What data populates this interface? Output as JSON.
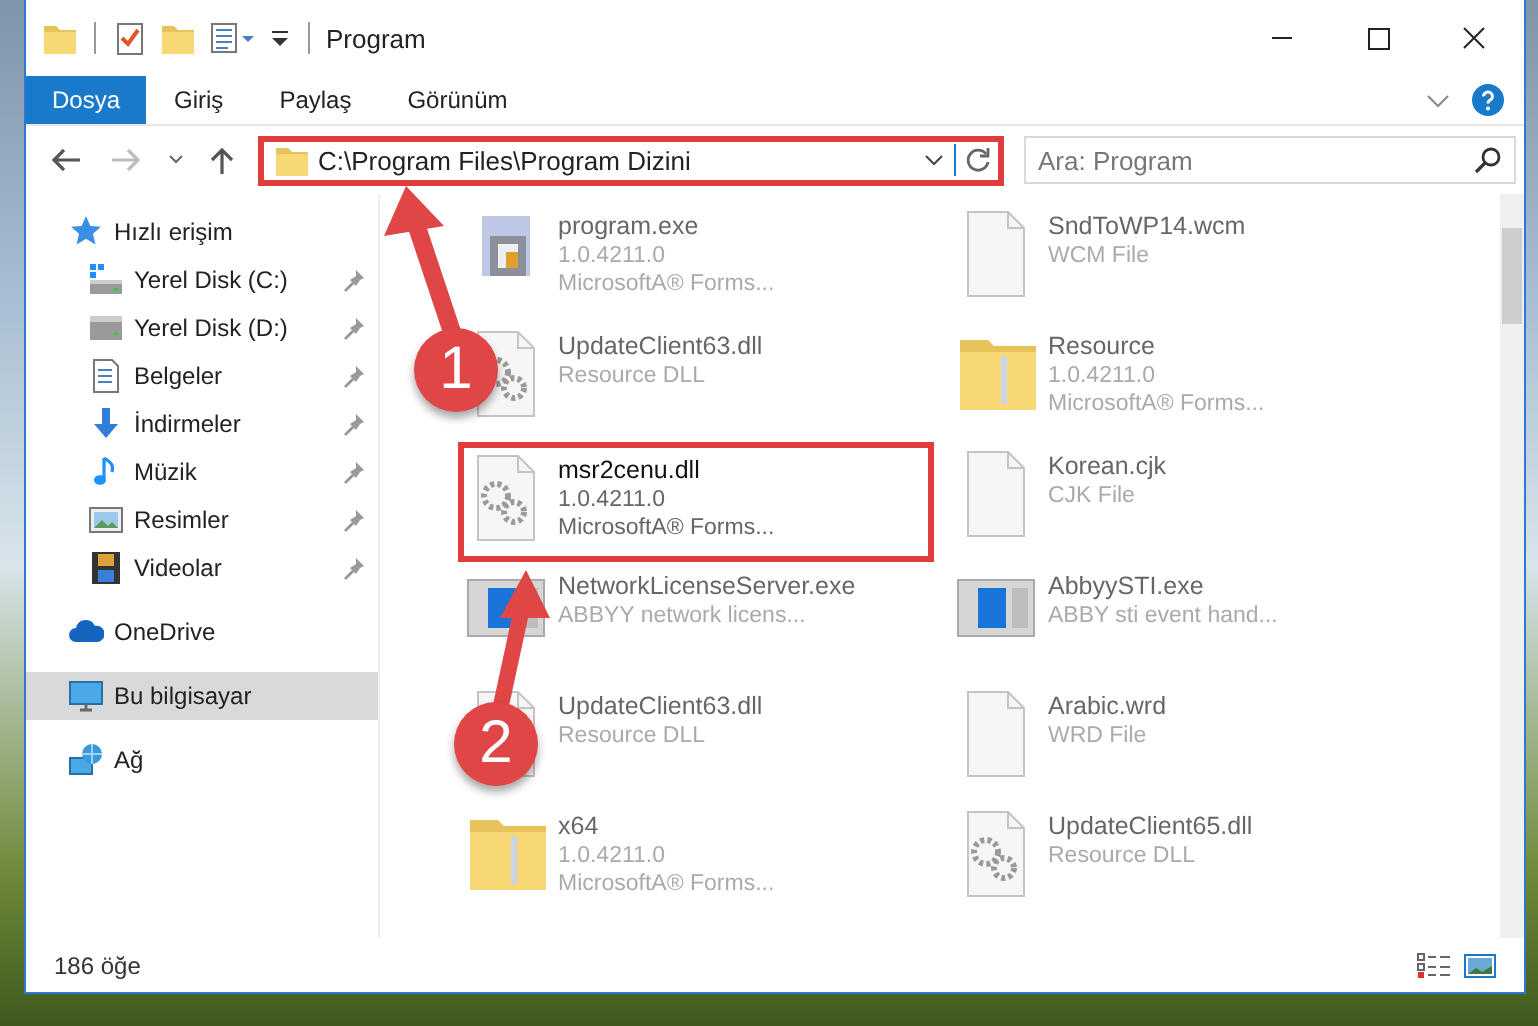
{
  "window": {
    "title": "Program"
  },
  "ribbon_tabs": [
    {
      "label": "Dosya",
      "kind": "menu",
      "selected": false
    },
    {
      "label": "Giriş",
      "kind": "tab",
      "selected": false
    },
    {
      "label": "Paylaş",
      "kind": "tab",
      "selected": false
    },
    {
      "label": "Görünüm",
      "kind": "tab",
      "selected": false
    }
  ],
  "address_bar": {
    "path": "C:\\Program Files\\Program Dizini",
    "highlighted": true
  },
  "search": {
    "placeholder": "Ara: Program"
  },
  "sidebar": {
    "items": [
      {
        "label": "Hızlı erişim",
        "kind": "star",
        "selected": false,
        "children": [
          {
            "label": "Yerel Disk (C:)",
            "kind": "system-drive",
            "selected": false,
            "pinned": true
          },
          {
            "label": "Yerel Disk (D:)",
            "kind": "drive",
            "selected": false,
            "pinned": true
          },
          {
            "label": "Belgeler",
            "kind": "documents",
            "selected": false,
            "pinned": true
          },
          {
            "label": "İndirmeler",
            "kind": "downloads",
            "selected": false,
            "pinned": true
          },
          {
            "label": "Müzik",
            "kind": "music",
            "selected": false,
            "pinned": true
          },
          {
            "label": "Resimler",
            "kind": "pictures",
            "selected": false,
            "pinned": true
          },
          {
            "label": "Videolar",
            "kind": "videos",
            "selected": false,
            "pinned": true
          }
        ]
      },
      {
        "label": "OneDrive",
        "kind": "cloud",
        "selected": false
      },
      {
        "label": "Bu bilgisayar",
        "kind": "computer",
        "selected": true
      },
      {
        "label": "Ağ",
        "kind": "network",
        "selected": false
      }
    ]
  },
  "files": [
    {
      "name": "program.exe",
      "kind": "program",
      "highlighted": false,
      "details": [
        "1.0.4211.0",
        "MicrosoftA® Forms..."
      ]
    },
    {
      "name": "SndToWP14.wcm",
      "kind": "document",
      "highlighted": false,
      "details": [
        "WCM File"
      ]
    },
    {
      "name": "UpdateClient63.dll",
      "kind": "dll",
      "highlighted": false,
      "details": [
        "Resource DLL"
      ]
    },
    {
      "name": "Resource",
      "kind": "folder",
      "highlighted": false,
      "details": [
        "1.0.4211.0",
        "MicrosoftA® Forms..."
      ]
    },
    {
      "name": "msr2cenu.dll",
      "kind": "dll",
      "highlighted": true,
      "details": [
        "1.0.4211.0",
        "MicrosoftA® Forms..."
      ]
    },
    {
      "name": "Korean.cjk",
      "kind": "document",
      "highlighted": false,
      "details": [
        "CJK File"
      ]
    },
    {
      "name": "NetworkLicenseServer.exe",
      "kind": "app",
      "highlighted": false,
      "details": [
        "ABBYY network licens..."
      ]
    },
    {
      "name": "AbbyySTI.exe",
      "kind": "app",
      "highlighted": false,
      "details": [
        "ABBY sti event hand..."
      ]
    },
    {
      "name": "UpdateClient63.dll",
      "kind": "dll",
      "highlighted": false,
      "details": [
        "Resource DLL"
      ]
    },
    {
      "name": "Arabic.wrd",
      "kind": "document",
      "highlighted": false,
      "details": [
        "WRD File"
      ]
    },
    {
      "name": "x64",
      "kind": "folder",
      "highlighted": false,
      "details": [
        "1.0.4211.0",
        "MicrosoftA® Forms..."
      ]
    },
    {
      "name": "UpdateClient65.dll",
      "kind": "dll",
      "highlighted": false,
      "details": [
        "Resource DLL"
      ]
    }
  ],
  "status_bar": {
    "count": "186 öğe"
  },
  "callouts": [
    {
      "number": "1"
    },
    {
      "number": "2"
    }
  ]
}
